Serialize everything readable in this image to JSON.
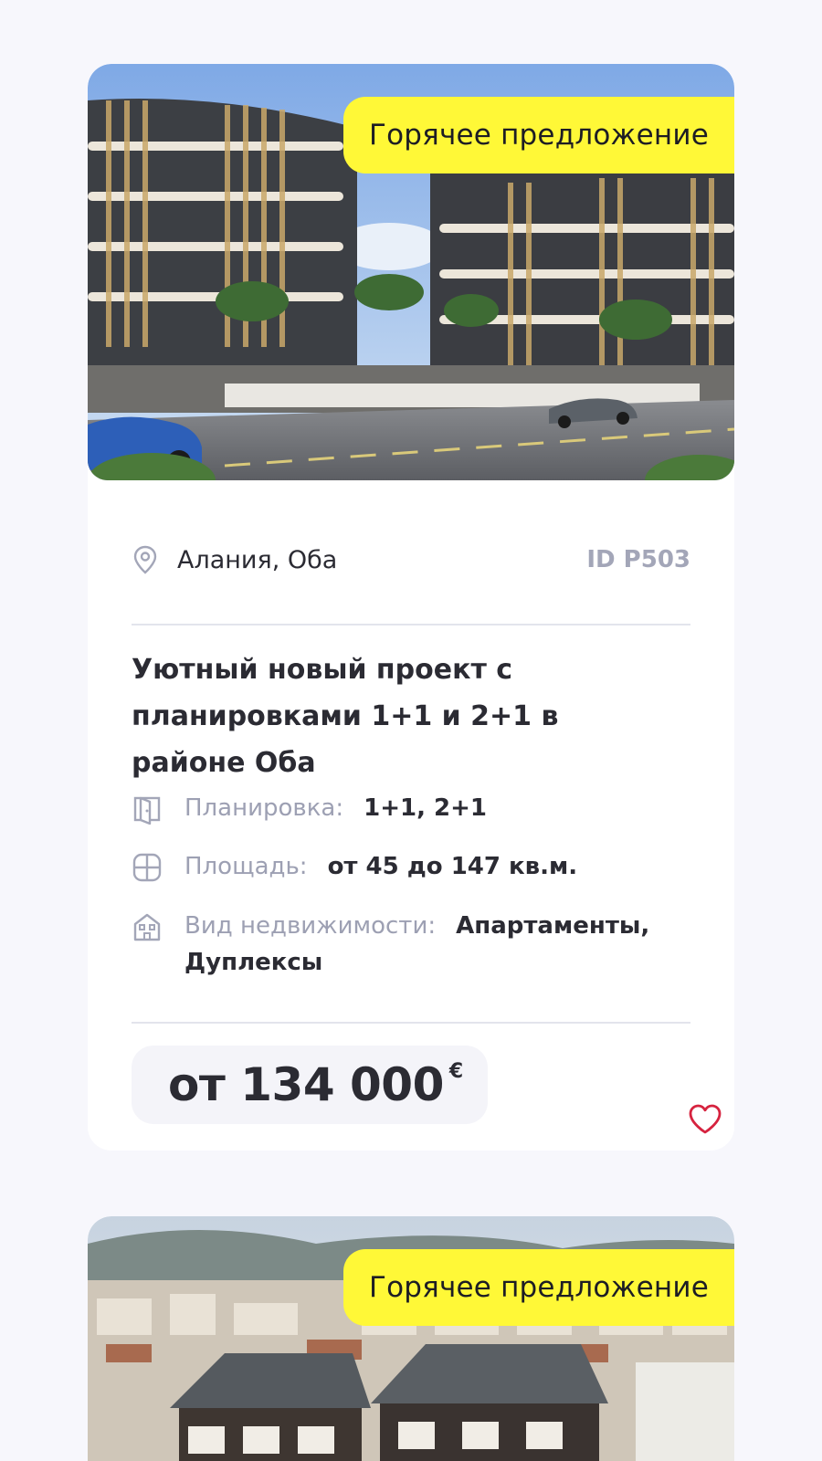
{
  "listings": [
    {
      "badge": "Горячее предложение",
      "location": "Алания, Оба",
      "id": "ID P503",
      "title": "Уютный новый проект с планировками 1+1 и 2+1 в районе Оба",
      "specs": [
        {
          "icon": "door-icon",
          "label": "Планировка:",
          "value": "1+1, 2+1"
        },
        {
          "icon": "area-grid-icon",
          "label": "Площадь:",
          "value": "от 45 до 147 кв.м."
        },
        {
          "icon": "building-icon",
          "label": "Вид недвижимости:",
          "value": "Апартаменты, Дуплексы"
        }
      ],
      "price": "от 134 000",
      "currency": "€",
      "favorite_icon": "heart-icon"
    },
    {
      "badge": "Горячее предложение"
    }
  ],
  "colors": {
    "page_bg": "#f7f7fc",
    "badge_bg": "#fff837",
    "muted_text": "#a3a6b8",
    "heart": "#d6233f"
  }
}
